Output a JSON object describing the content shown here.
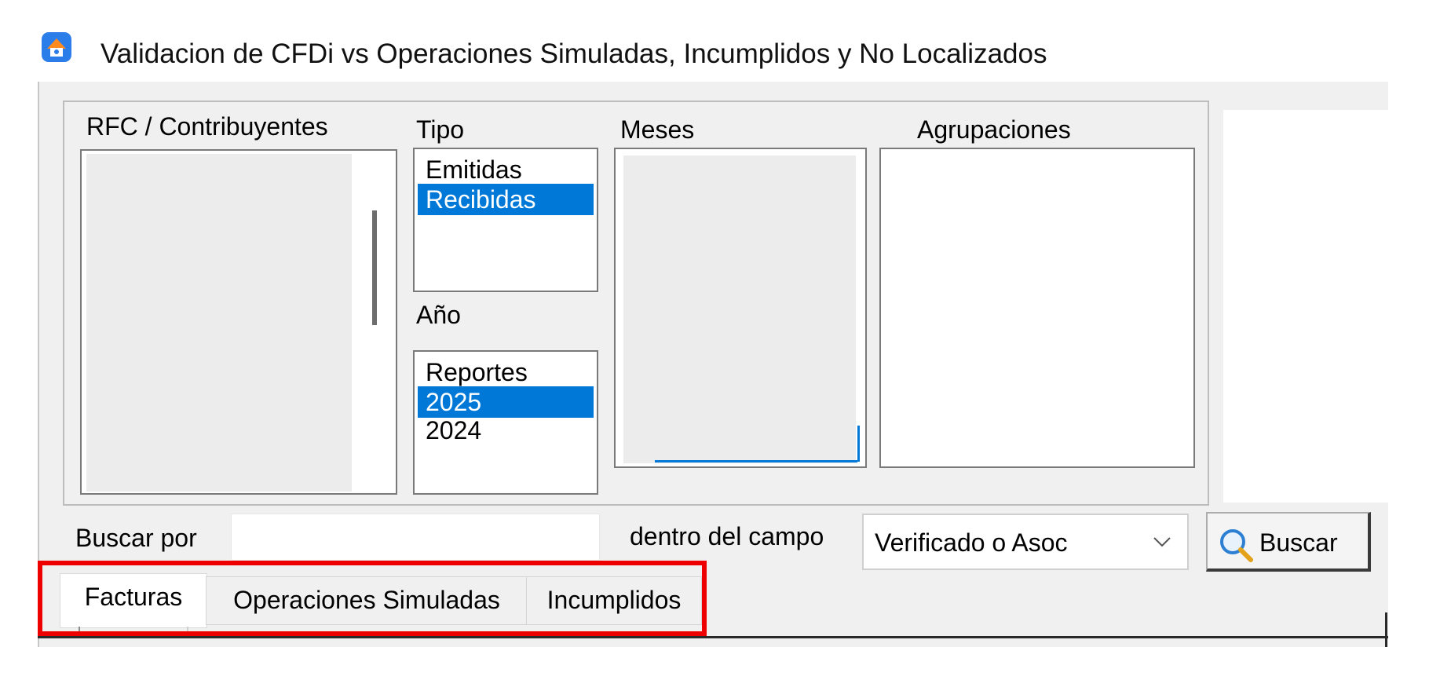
{
  "window": {
    "title": "Validacion de CFDi vs Operaciones Simuladas, Incumplidos y No Localizados"
  },
  "filters": {
    "rfc": {
      "label": "RFC / Contribuyentes",
      "items": []
    },
    "tipo": {
      "label": "Tipo",
      "items": [
        "Emitidas",
        "Recibidas"
      ],
      "selected": "Recibidas"
    },
    "anio": {
      "label": "Año",
      "items": [
        "Reportes",
        "2025",
        "2024"
      ],
      "selected": "2025"
    },
    "meses": {
      "label": "Meses",
      "items": []
    },
    "agrupaciones": {
      "label": "Agrupaciones",
      "items": []
    }
  },
  "search": {
    "label": "Buscar por",
    "value": "",
    "field_label": "dentro del campo",
    "field_value": "Verificado o Asoc",
    "button_label": "Buscar"
  },
  "tabs": [
    {
      "label": "Facturas",
      "active": true
    },
    {
      "label": "Operaciones Simuladas",
      "active": false
    },
    {
      "label": "Incumplidos",
      "active": false
    }
  ],
  "colors": {
    "selection": "#0078d7",
    "highlight": "#ee0000",
    "window_bg": "#f0f0f0"
  },
  "icons": {
    "app": "app-logo-icon",
    "dropdown": "chevron-down-icon",
    "search": "magnifier-icon"
  }
}
